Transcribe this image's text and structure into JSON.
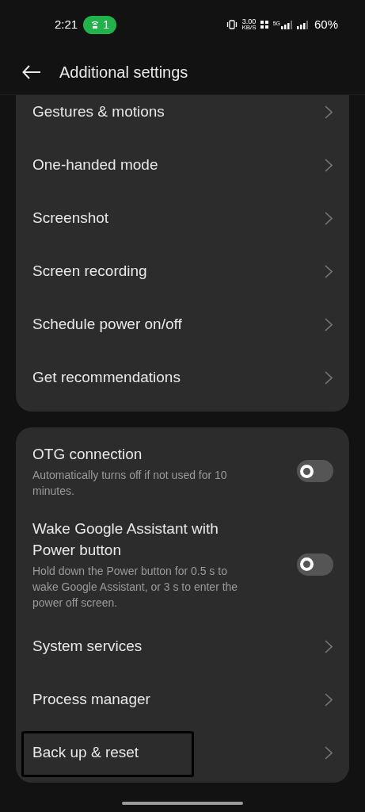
{
  "status_bar": {
    "time": "2:21",
    "hotspot_count": "1",
    "net_speed": "3.00",
    "net_speed_unit": "KB/S",
    "network": "5G",
    "battery": "60%"
  },
  "header": {
    "title": "Additional settings"
  },
  "groups": [
    {
      "items": [
        {
          "kind": "link",
          "title": "Gestures & motions"
        },
        {
          "kind": "link",
          "title": "One-handed mode"
        },
        {
          "kind": "link",
          "title": "Screenshot"
        },
        {
          "kind": "link",
          "title": "Screen recording"
        },
        {
          "kind": "link",
          "title": "Schedule power on/off"
        },
        {
          "kind": "link",
          "title": "Get recommendations"
        }
      ]
    },
    {
      "items": [
        {
          "kind": "toggle",
          "title": "OTG connection",
          "description": "Automatically turns off if not used for 10 minutes.",
          "on": false
        },
        {
          "kind": "toggle",
          "title": "Wake Google Assistant with Power button",
          "description": "Hold down the Power button for 0.5 s to wake Google Assistant, or 3 s to enter the power off screen.",
          "on": false
        },
        {
          "kind": "link",
          "title": "System services"
        },
        {
          "kind": "link",
          "title": "Process manager"
        },
        {
          "kind": "link",
          "title": "Back up & reset",
          "circled": true
        }
      ]
    }
  ]
}
